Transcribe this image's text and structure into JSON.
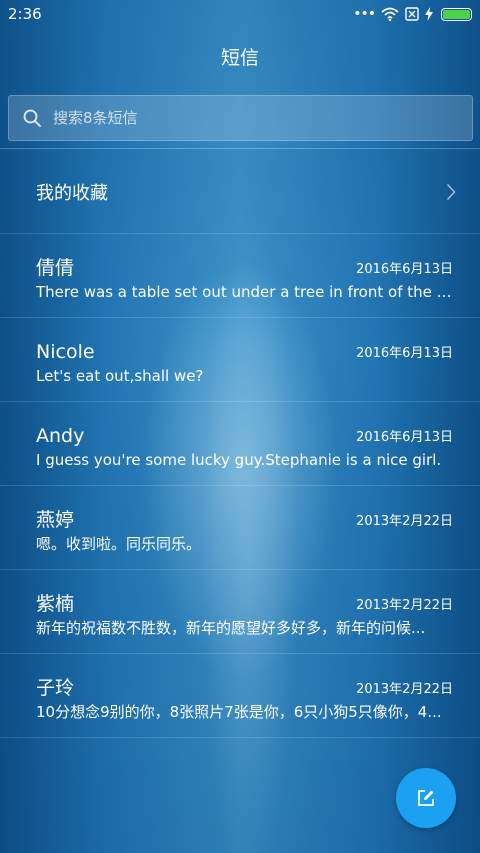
{
  "status_bar": {
    "time": "2:36",
    "dots": "•••",
    "battery_level": 1.0,
    "battery_color": "#4bd14a"
  },
  "header": {
    "title": "短信"
  },
  "search": {
    "placeholder": "搜索8条短信",
    "value": ""
  },
  "favorites": {
    "label": "我的收藏"
  },
  "conversations": [
    {
      "name": "倩倩",
      "date": "2016年6月13日",
      "preview": "There was a table set out under a tree in front of the ho..."
    },
    {
      "name": "Nicole",
      "date": "2016年6月13日",
      "preview": "Let's eat out,shall we?"
    },
    {
      "name": "Andy",
      "date": "2016年6月13日",
      "preview": "I guess you're some lucky guy.Stephanie is a nice girl."
    },
    {
      "name": "燕婷",
      "date": "2013年2月22日",
      "preview": "嗯。收到啦。同乐同乐。"
    },
    {
      "name": "紫楠",
      "date": "2013年2月22日",
      "preview": "新年的祝福数不胜数，新年的愿望好多好多，新年的问候..."
    },
    {
      "name": "子玲",
      "date": "2013年2月22日",
      "preview": "10分想念9别的你，8张照片7张是你，6只小狗5只像你，4..."
    }
  ],
  "fab": {
    "icon": "compose-icon",
    "color": "#1ba0f2"
  }
}
